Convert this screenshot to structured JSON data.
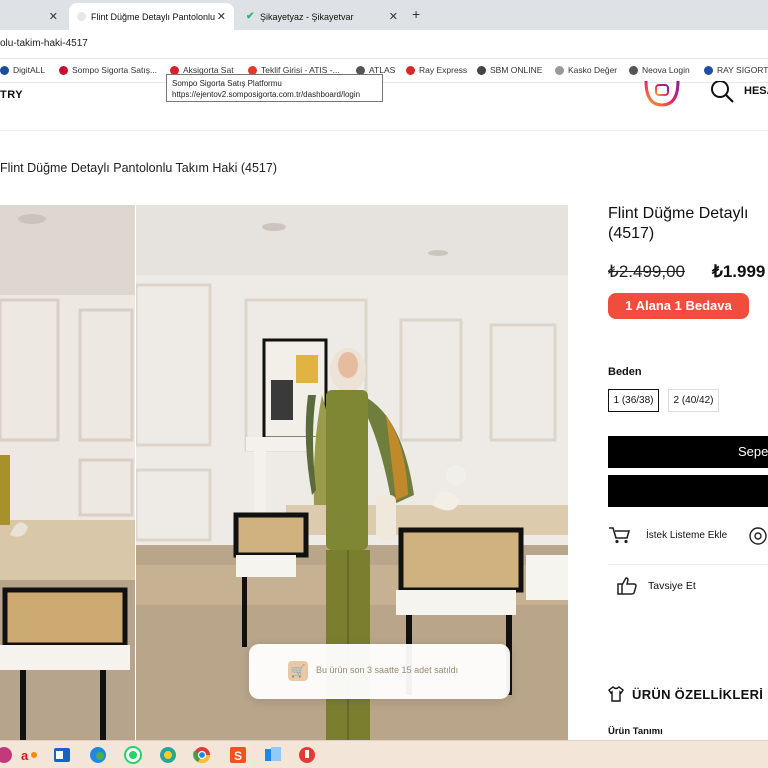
{
  "browser": {
    "tabs": [
      {
        "title": ""
      },
      {
        "title": "Flint Düğme Detaylı Pantolonlu"
      },
      {
        "title": "Şikayetyaz - Şikayetvar"
      }
    ],
    "url": "olu-takim-haki-4517",
    "bookmarks": [
      {
        "label": "DigitALL",
        "color": "#1b4d9b"
      },
      {
        "label": "Sompo Sigorta Satış...",
        "color": "#c8102e"
      },
      {
        "label": "Aksigorta Sat",
        "color": "#d8202a"
      },
      {
        "label": "Teklif Girisi - ATIS -...",
        "color": "#e03a2f"
      },
      {
        "label": "ATLAS",
        "color": "#555555"
      },
      {
        "label": "Ray Express",
        "color": "#d62828"
      },
      {
        "label": "SBM ONLINE",
        "color": "#444444"
      },
      {
        "label": "Kasko Değer",
        "color": "#999999"
      },
      {
        "label": "Neova Login",
        "color": "#555555"
      },
      {
        "label": "RAY SIGORTA",
        "color": "#1e4fa0"
      }
    ],
    "tooltip": {
      "line1": "Sompo Sigorta Satış Platformu",
      "line2": "https://ejentov2.somposigorta.com.tr/dashboard/login"
    }
  },
  "header": {
    "brand_fragment": "TRY",
    "account_fragment": "HESA"
  },
  "breadcrumb_title": "Flint Düğme Detaylı Pantolonlu Takım Haki (4517)",
  "product": {
    "title": "Flint Düğme Detaylı\n(4517)",
    "old_price": "₺2.499,00",
    "new_price": "₺1.999",
    "promo": "1 Alana 1 Bedava",
    "size_label": "Beden",
    "sizes": [
      {
        "label": "1 (36/38)",
        "selected": true
      },
      {
        "label": "2 (40/42)",
        "selected": false
      }
    ],
    "add_to_cart": "Sepe",
    "second_button": "",
    "wishlist": "İstek Listeme Ekle",
    "recommend": "Tavsiye Et",
    "features_heading": "ÜRÜN ÖZELLİKLERİ",
    "description_heading": "Ürün Tanımı"
  },
  "sales_toast": "Bu ürün son 3 saatte 15 adet satıldı",
  "colors": {
    "promo_bg": "#f04d3c",
    "button_bg": "#000000",
    "taskbar_bg": "#f3e6d9"
  },
  "taskbar_icons": [
    "edge-app-icon",
    "opera-icon",
    "outlook-icon",
    "edge-icon",
    "whatsapp-icon",
    "browser-icon",
    "chrome-icon",
    "app-s-icon",
    "office-icon",
    "app-red-icon"
  ]
}
